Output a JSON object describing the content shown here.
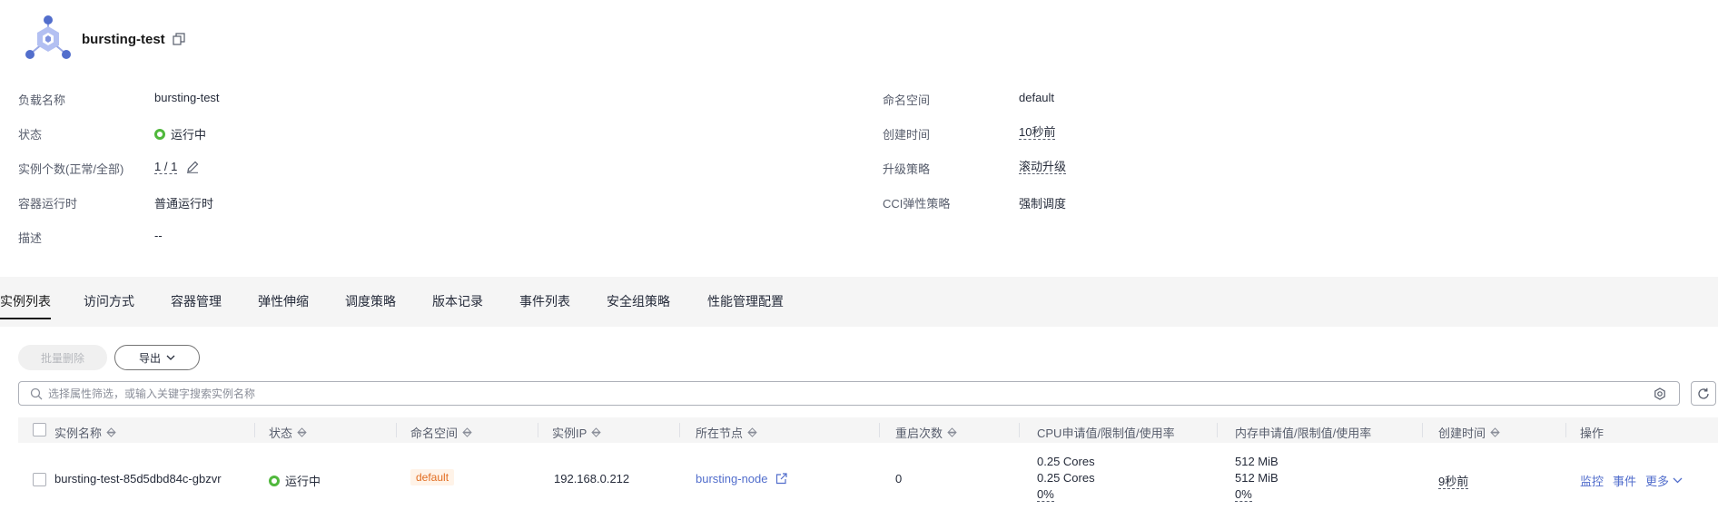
{
  "header": {
    "title": "bursting-test"
  },
  "details": {
    "left": [
      {
        "label": "负载名称",
        "value": "bursting-test"
      },
      {
        "label": "状态",
        "value": "运行中"
      },
      {
        "label": "实例个数(正常/全部)",
        "value": "1 / 1"
      },
      {
        "label": "容器运行时",
        "value": "普通运行时"
      },
      {
        "label": "描述",
        "value": "--"
      }
    ],
    "right": [
      {
        "label": "命名空间",
        "value": "default"
      },
      {
        "label": "创建时间",
        "value": "10秒前"
      },
      {
        "label": "升级策略",
        "value": "滚动升级"
      },
      {
        "label": "CCI弹性策略",
        "value": "强制调度"
      }
    ]
  },
  "tabs": [
    {
      "label": "实例列表",
      "active": true
    },
    {
      "label": "访问方式"
    },
    {
      "label": "容器管理"
    },
    {
      "label": "弹性伸缩"
    },
    {
      "label": "调度策略"
    },
    {
      "label": "版本记录"
    },
    {
      "label": "事件列表"
    },
    {
      "label": "安全组策略"
    },
    {
      "label": "性能管理配置"
    }
  ],
  "toolbar": {
    "batch_delete": "批量删除",
    "export": "导出"
  },
  "search": {
    "placeholder": "选择属性筛选，或输入关键字搜索实例名称"
  },
  "table": {
    "columns": [
      "实例名称",
      "状态",
      "命名空间",
      "实例IP",
      "所在节点",
      "重启次数",
      "CPU申请值/限制值/使用率",
      "内存申请值/限制值/使用率",
      "创建时间",
      "操作"
    ],
    "rows": [
      {
        "name": "bursting-test-85d5dbd84c-gbzvr",
        "status": "运行中",
        "namespace": "default",
        "ip": "192.168.0.212",
        "node": "bursting-node",
        "restarts": "0",
        "cpu": [
          "0.25 Cores",
          "0.25 Cores",
          "0%"
        ],
        "memory": [
          "512 MiB",
          "512 MiB",
          "0%"
        ],
        "created": "9秒前",
        "actions": [
          "监控",
          "事件",
          "更多"
        ]
      }
    ]
  },
  "colors": {
    "status_green": "#50b83c",
    "link_blue": "#526ecc",
    "badge_orange": "#e26d21",
    "logo_blue": "#526ecc"
  },
  "icons": {
    "logo": "cluster-hexagon-icon",
    "copy": "copy-icon",
    "edit": "edit-icon",
    "search": "search-icon",
    "settings": "settings-icon",
    "refresh": "refresh-icon",
    "sort": "sort-icon",
    "external": "external-link-icon",
    "chevron": "chevron-down-icon"
  }
}
